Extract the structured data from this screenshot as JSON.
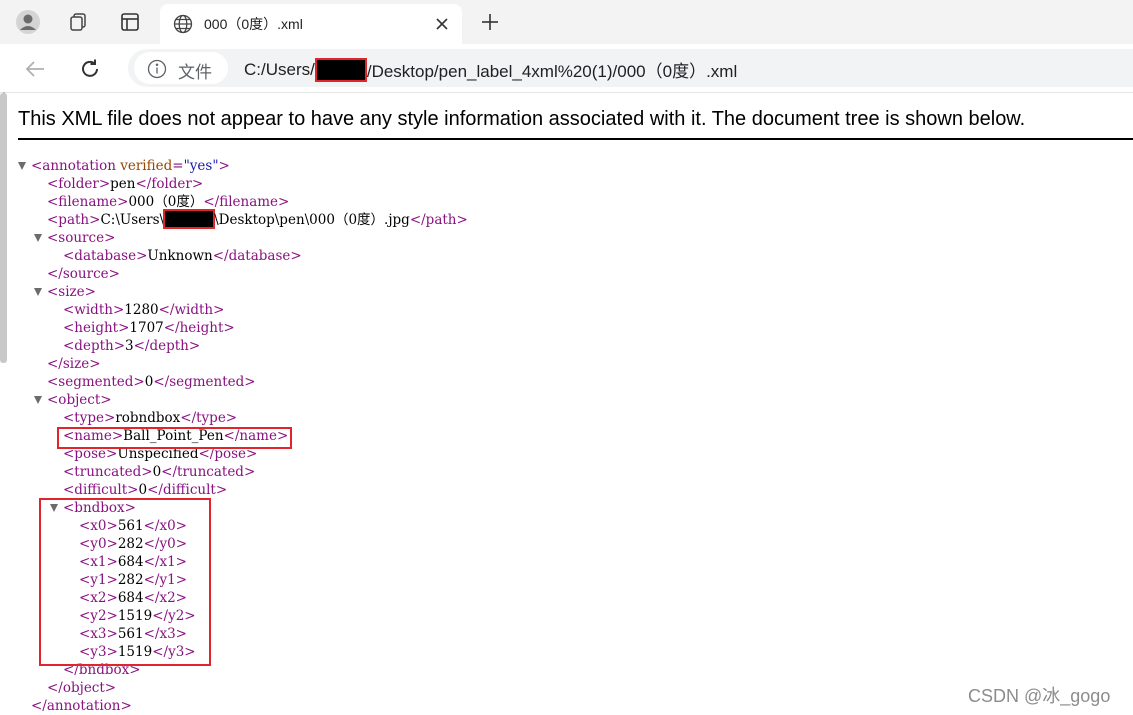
{
  "browser": {
    "tab_title": "000（0度）.xml",
    "site_info_label": "文件",
    "url_part1": "C:/Users/",
    "url_part2": "/Desktop/pen_label_4xml%20(1)/000（0度）.xml",
    "icons": [
      "profile-icon",
      "workspaces-icon",
      "vertical-tabs-icon",
      "globe-icon",
      "close-icon",
      "plus-icon",
      "back-icon",
      "refresh-icon",
      "info-icon"
    ]
  },
  "page": {
    "notice": "This XML file does not appear to have any style information associated with it. The document tree is shown below."
  },
  "xml": {
    "annotation_open_tag": "<annotation",
    "verified_attr": "verified",
    "verified_eq": "=",
    "verified_value": "\"yes\"",
    "annotation_open_close": ">",
    "folder_open": "<folder>",
    "folder_value": "pen",
    "folder_close": "</folder>",
    "filename_open": "<filename>",
    "filename_value": "000（0度）",
    "filename_close": "</filename>",
    "path_open": "<path>",
    "path_value_1": "C:\\Users\\",
    "path_value_2": "\\Desktop\\pen\\000（0度）.jpg",
    "path_close": "</path>",
    "source_open": "<source>",
    "database_open": "<database>",
    "database_value": "Unknown",
    "database_close": "</database>",
    "source_close": "</source>",
    "size_open": "<size>",
    "width_open": "<width>",
    "width_value": "1280",
    "width_close": "</width>",
    "height_open": "<height>",
    "height_value": "1707",
    "height_close": "</height>",
    "depth_open": "<depth>",
    "depth_value": "3",
    "depth_close": "</depth>",
    "size_close": "</size>",
    "segmented_open": "<segmented>",
    "segmented_value": "0",
    "segmented_close": "</segmented>",
    "object_open": "<object>",
    "type_open": "<type>",
    "type_value": "robndbox",
    "type_close": "</type>",
    "name_open": "<name>",
    "name_value": "Ball_Point_Pen",
    "name_close": "</name>",
    "pose_open": "<pose>",
    "pose_value": "Unspecified",
    "pose_close": "</pose>",
    "truncated_open": "<truncated>",
    "truncated_value": "0",
    "truncated_close": "</truncated>",
    "difficult_open": "<difficult>",
    "difficult_value": "0",
    "difficult_close": "</difficult>",
    "bndbox_open": "<bndbox>",
    "x0_open": "<x0>",
    "x0_value": "561",
    "x0_close": "</x0>",
    "y0_open": "<y0>",
    "y0_value": "282",
    "y0_close": "</y0>",
    "x1_open": "<x1>",
    "x1_value": "684",
    "x1_close": "</x1>",
    "y1_open": "<y1>",
    "y1_value": "282",
    "y1_close": "</y1>",
    "x2_open": "<x2>",
    "x2_value": "684",
    "x2_close": "</x2>",
    "y2_open": "<y2>",
    "y2_value": "1519",
    "y2_close": "</y2>",
    "x3_open": "<x3>",
    "x3_value": "561",
    "x3_close": "</x3>",
    "y3_open": "<y3>",
    "y3_value": "1519",
    "y3_close": "</y3>",
    "bndbox_close": "</bndbox>",
    "object_close": "</object>",
    "annotation_close": "</annotation>"
  },
  "watermark": "CSDN @冰_gogo",
  "colors": {
    "tag": "#881280",
    "attr": "#994500",
    "attr_value": "#1a1aa6",
    "highlight": "#e0262b"
  }
}
